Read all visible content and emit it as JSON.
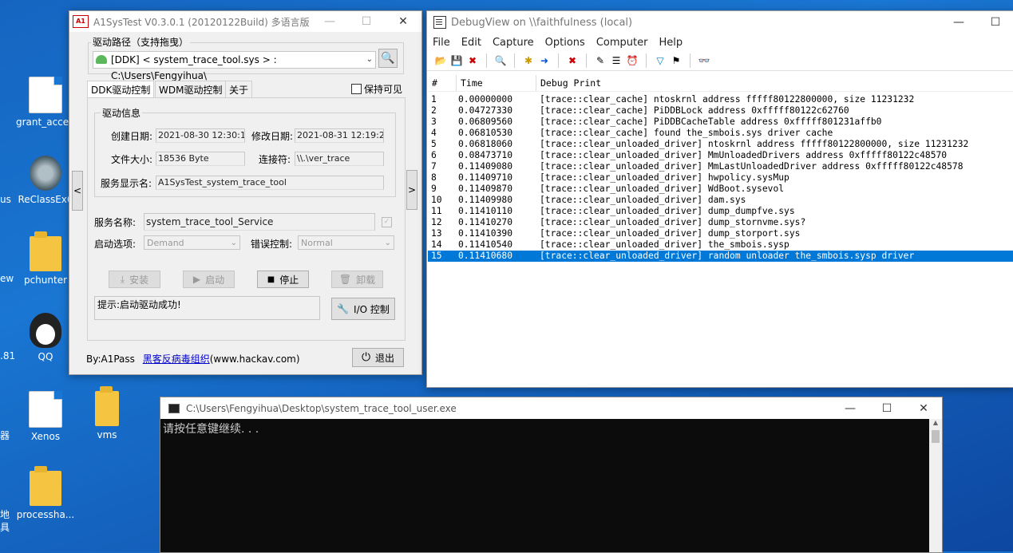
{
  "desktop": {
    "icons": [
      {
        "label": "grant_acce..."
      },
      {
        "label": "ReClassEx6"
      },
      {
        "label": "pchunter"
      },
      {
        "label": "QQ"
      },
      {
        "label": "Xenos"
      },
      {
        "label": "vms"
      },
      {
        "label": "processha..."
      }
    ],
    "edge_texts": [
      "us",
      "ew",
      ".81",
      "器",
      "地",
      "具"
    ]
  },
  "a1": {
    "title": "A1SysTest V0.3.0.1  (20120122Build) 多语言版",
    "logo_text": "A1",
    "driver_path_label": "驱动路径（支持拖曳）",
    "driver_path_value": "[DDK] < system_trace_tool.sys > :  C:\\Users\\Fengyihua\\",
    "tabs": [
      "DDK驱动控制",
      "WDM驱动控制",
      "关于"
    ],
    "keep_visible": "保持可见",
    "info_group": "驱动信息",
    "created_label": "创建日期:",
    "created_value": "2021-08-30 12:30:18",
    "modified_label": "修改日期:",
    "modified_value": "2021-08-31 12:19:24",
    "size_label": "文件大小:",
    "size_value": "18536  Byte",
    "link_label": "连接符:",
    "link_value": "\\\\.\\ver_trace",
    "display_label": "服务显示名:",
    "display_value": "A1SysTest_system_trace_tool",
    "service_label": "服务名称:",
    "service_value": "system_trace_tool_Service",
    "start_label": "启动选项:",
    "start_value": "Demand",
    "error_label": "错误控制:",
    "error_value": "Normal",
    "buttons": {
      "install": "安装",
      "start": "启动",
      "stop": "停止",
      "uninstall": "卸载",
      "io": "I/O 控制",
      "exit": "退出"
    },
    "status": "提示:启动驱动成功!",
    "footer_prefix": "By:A1Pass",
    "footer_link": "黑客反病毒组织",
    "footer_suffix": "(www.hackav.com)"
  },
  "debugview": {
    "title": "DebugView on \\\\faithfulness (local)",
    "menu": [
      "File",
      "Edit",
      "Capture",
      "Options",
      "Computer",
      "Help"
    ],
    "columns": [
      "#",
      "Time",
      "Debug Print"
    ],
    "rows": [
      {
        "n": "1",
        "t": "0.00000000",
        "m": "[trace::clear_cache] ntoskrnl address fffff80122800000, size 11231232"
      },
      {
        "n": "2",
        "t": "0.04727330",
        "m": "[trace::clear_cache] PiDDBLock address 0xfffff80122c62760"
      },
      {
        "n": "3",
        "t": "0.06809560",
        "m": "[trace::clear_cache] PiDDBCacheTable address 0xfffff801231affb0"
      },
      {
        "n": "4",
        "t": "0.06810530",
        "m": "[trace::clear_cache] found the_smbois.sys driver cache"
      },
      {
        "n": "5",
        "t": "0.06818060",
        "m": "[trace::clear_unloaded_driver] ntoskrnl address fffff80122800000, size 11231232"
      },
      {
        "n": "6",
        "t": "0.08473710",
        "m": "[trace::clear_unloaded_driver] MmUnloadedDrivers address 0xfffff80122c48570"
      },
      {
        "n": "7",
        "t": "0.11409080",
        "m": "[trace::clear_unloaded_driver] MmLastUnloadedDriver address 0xfffff80122c48578"
      },
      {
        "n": "8",
        "t": "0.11409710",
        "m": "[trace::clear_unloaded_driver] hwpolicy.sysMup"
      },
      {
        "n": "9",
        "t": "0.11409870",
        "m": "[trace::clear_unloaded_driver] WdBoot.sysevol"
      },
      {
        "n": "10",
        "t": "0.11409980",
        "m": "[trace::clear_unloaded_driver] dam.sys"
      },
      {
        "n": "11",
        "t": "0.11410110",
        "m": "[trace::clear_unloaded_driver] dump_dumpfve.sys"
      },
      {
        "n": "12",
        "t": "0.11410270",
        "m": "[trace::clear_unloaded_driver] dump_stornvme.sys?"
      },
      {
        "n": "13",
        "t": "0.11410390",
        "m": "[trace::clear_unloaded_driver] dump_storport.sys"
      },
      {
        "n": "14",
        "t": "0.11410540",
        "m": "[trace::clear_unloaded_driver] the_smbois.sysp"
      },
      {
        "n": "15",
        "t": "0.11410680",
        "m": "[trace::clear_unloaded_driver] random unloader the_smbois.sysp driver"
      }
    ]
  },
  "console": {
    "title": "C:\\Users\\Fengyihua\\Desktop\\system_trace_tool_user.exe",
    "output": "请按任意键继续. . ."
  },
  "colors": {
    "selection": "#0078d7",
    "desktop": "#1976d2",
    "link": "#0000cc"
  }
}
